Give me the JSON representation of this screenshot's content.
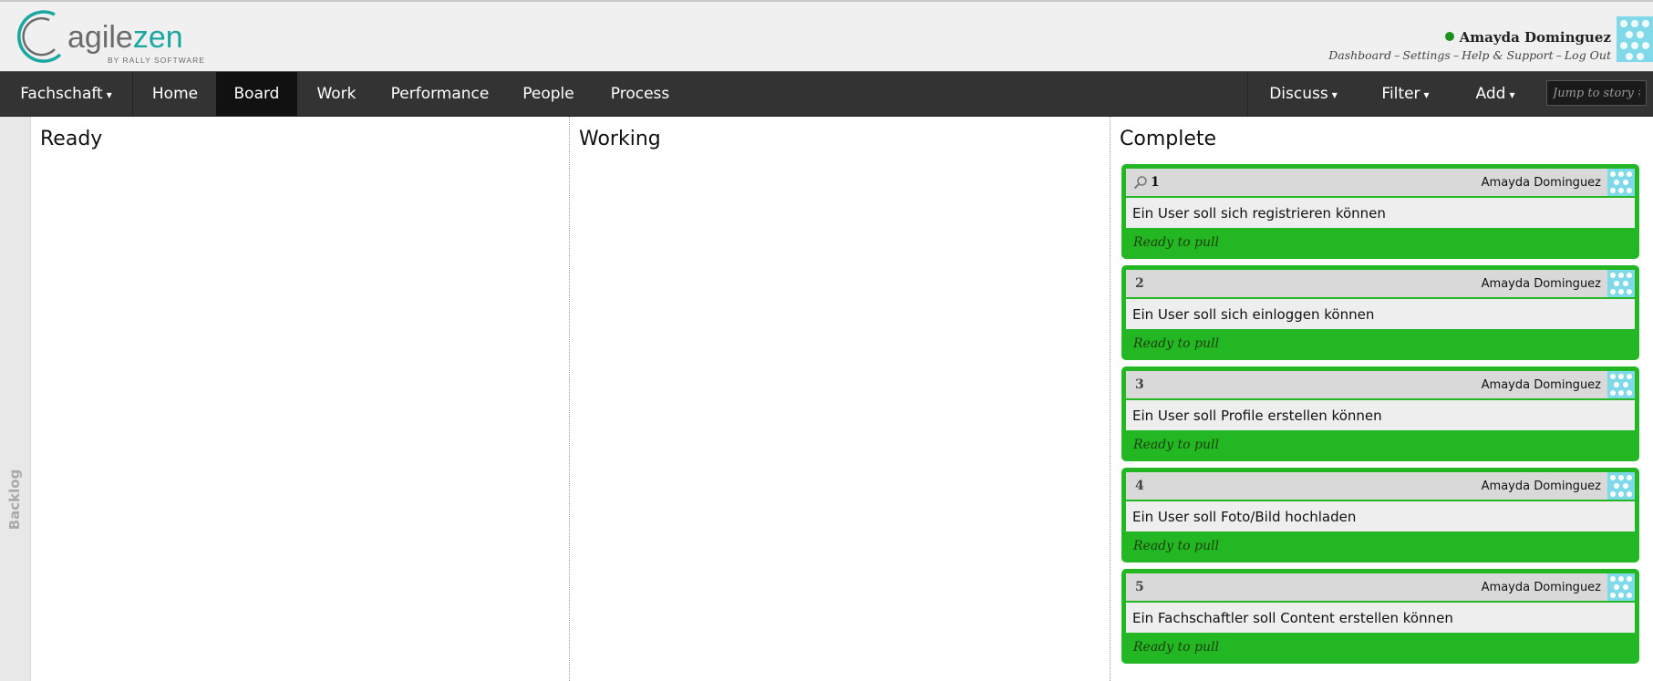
{
  "app": {
    "logo_text": "agilezen",
    "logo_sub": "BY RALLY SOFTWARE",
    "colors": {
      "logo_gray": "#6b6b6b",
      "logo_teal": "#1aa7a0",
      "nav_bg": "#333333",
      "card_green": "#23b823"
    }
  },
  "user": {
    "name": "Amayda Dominguez",
    "links": [
      "Dashboard",
      "Settings",
      "Help & Support",
      "Log Out"
    ],
    "separator": "–"
  },
  "nav": {
    "left": [
      {
        "label": "Fachschaft",
        "caret": "▾"
      },
      {
        "label": "Home"
      },
      {
        "label": "Board",
        "active": true
      },
      {
        "label": "Work"
      },
      {
        "label": "Performance"
      },
      {
        "label": "People"
      },
      {
        "label": "Process"
      }
    ],
    "right": [
      {
        "label": "Discuss",
        "caret": "▾"
      },
      {
        "label": "Filter",
        "caret": "▾"
      },
      {
        "label": "Add",
        "caret": "▾"
      }
    ],
    "jump_placeholder": "Jump to story #"
  },
  "board": {
    "backlog_label": "Backlog",
    "columns": [
      {
        "title": "Ready"
      },
      {
        "title": "Working"
      },
      {
        "title": "Complete"
      }
    ],
    "cards": [
      {
        "number": "1",
        "owner": "Amayda Dominguez",
        "text": "Ein User soll sich registrieren können",
        "status": "Ready to pull",
        "icon": "zoom-icon"
      },
      {
        "number": "2",
        "owner": "Amayda Dominguez",
        "text": "Ein User soll sich einloggen können",
        "status": "Ready to pull"
      },
      {
        "number": "3",
        "owner": "Amayda Dominguez",
        "text": "Ein User soll Profile erstellen können",
        "status": "Ready to pull"
      },
      {
        "number": "4",
        "owner": "Amayda Dominguez",
        "text": "Ein User soll Foto/Bild hochladen",
        "status": "Ready to pull"
      },
      {
        "number": "5",
        "owner": "Amayda Dominguez",
        "text": "Ein Fachschaftler soll Content erstellen können",
        "status": "Ready to pull"
      }
    ]
  }
}
